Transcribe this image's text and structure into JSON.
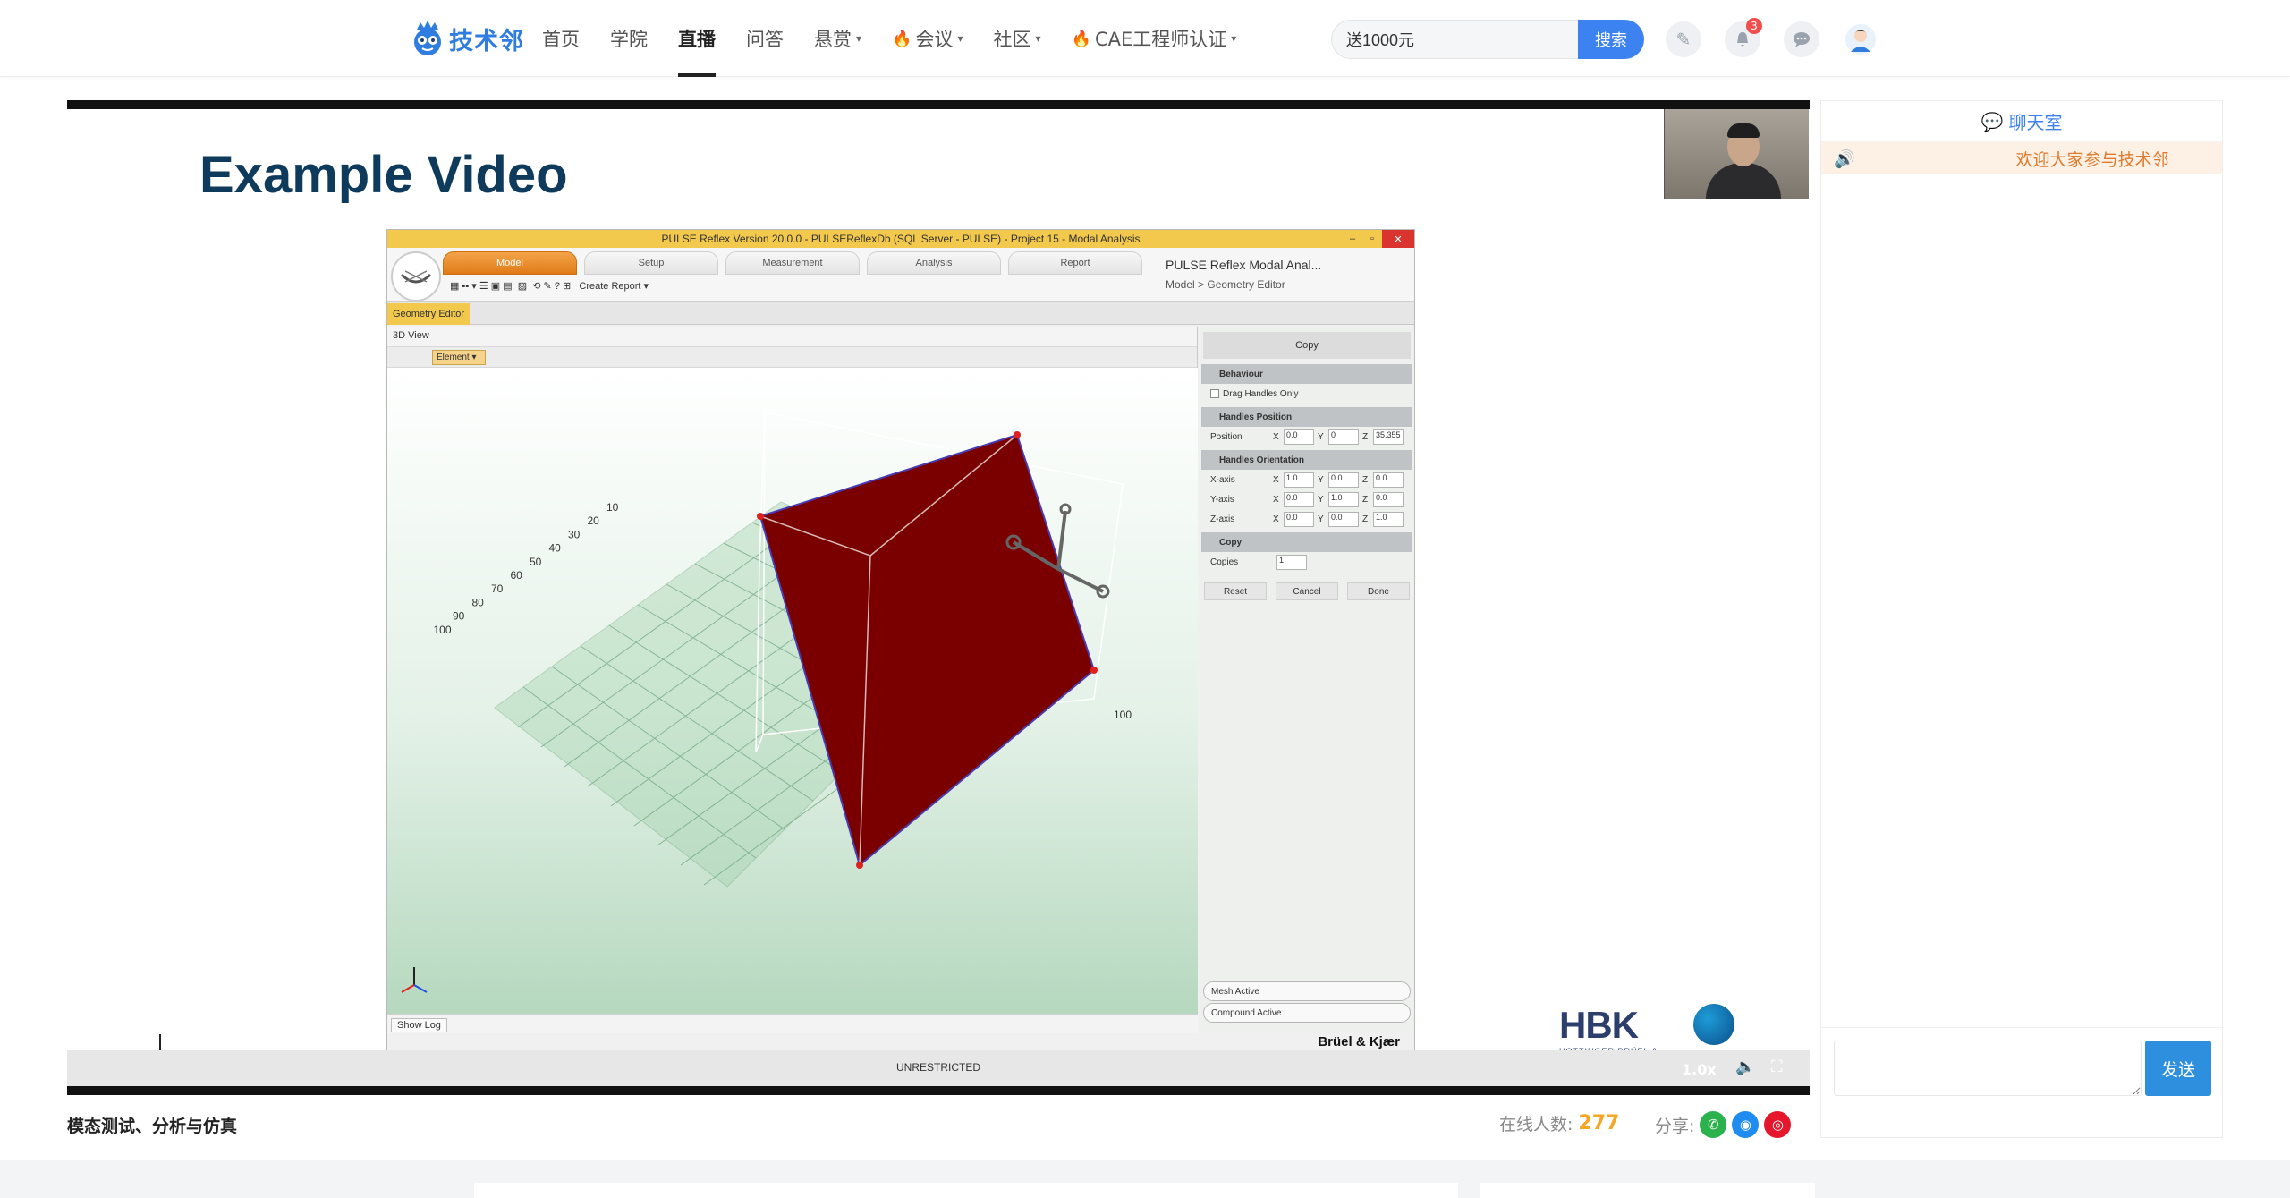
{
  "nav": {
    "logo_text": "技术邻",
    "items": [
      {
        "label": "首页",
        "active": false,
        "caret": false,
        "flame": false
      },
      {
        "label": "学院",
        "active": false,
        "caret": false,
        "flame": false
      },
      {
        "label": "直播",
        "active": true,
        "caret": false,
        "flame": false
      },
      {
        "label": "问答",
        "active": false,
        "caret": false,
        "flame": false
      },
      {
        "label": "悬赏",
        "active": false,
        "caret": true,
        "flame": false
      },
      {
        "label": "会议",
        "active": false,
        "caret": true,
        "flame": true
      },
      {
        "label": "社区",
        "active": false,
        "caret": true,
        "flame": false
      },
      {
        "label": "CAE工程师认证",
        "active": false,
        "caret": true,
        "flame": true
      }
    ],
    "search_value": "送1000元",
    "search_button": "搜索",
    "notification_count": "3"
  },
  "player": {
    "slide_title": "Example Video",
    "app": {
      "titlebar": "PULSE Reflex Version 20.0.0 - PULSEReflexDb (SQL Server - PULSE) - Project 15 - Modal Analysis",
      "tabs": [
        "Model",
        "Setup",
        "Measurement",
        "Analysis",
        "Report"
      ],
      "create_report": "Create Report",
      "ribbon_title": "PULSE Reflex  Modal Anal...",
      "ribbon_path": "Model > Geometry Editor",
      "editor_tab": "Geometry Editor",
      "viewport_title": "3D View",
      "element_select": "Element",
      "axis_ticks": [
        "10",
        "20",
        "30",
        "40",
        "50",
        "60",
        "70",
        "80",
        "90",
        "100"
      ],
      "axis_tick_right": "100",
      "props": {
        "copy_title": "Copy",
        "behaviour": "Behaviour",
        "drag_handles": "Drag Handles Only",
        "handles_position": "Handles Position",
        "position_label": "Position",
        "position": {
          "x": "0.0",
          "y": "0",
          "z": "35.355"
        },
        "handles_orientation": "Handles Orientation",
        "xaxis_label": "X-axis",
        "yaxis_label": "Y-axis",
        "zaxis_label": "Z-axis",
        "xaxis": {
          "x": "1.0",
          "y": "0.0",
          "z": "0.0"
        },
        "yaxis": {
          "x": "0.0",
          "y": "1.0",
          "z": "0.0"
        },
        "zaxis": {
          "x": "0.0",
          "y": "0.0",
          "z": "1.0"
        },
        "copy_section": "Copy",
        "copies_label": "Copies",
        "copies": "1",
        "reset": "Reset",
        "cancel": "Cancel",
        "done": "Done",
        "mesh_active": "Mesh Active",
        "compound_active": "Compound Active"
      },
      "show_log": "Show Log",
      "brand": "Brüel & Kjær"
    },
    "hbk_logo": "HBK",
    "hbk_sub": "HOTTINGER BRÜEL & KJÆR",
    "unrestricted": "UNRESTRICTED",
    "speed": "1.0x"
  },
  "video_info": {
    "title": "模态测试、分析与仿真",
    "online_label": "在线人数:",
    "online_count": "277",
    "share_label": "分享:"
  },
  "chat": {
    "title": "聊天室",
    "notice": "欢迎大家参与技术邻",
    "send_label": "发送"
  },
  "colors": {
    "accent": "#3c82f0",
    "online_count": "#f5a623",
    "notice_text": "#e07b2e",
    "panel_face": "#7a0000",
    "ribbon_active": "#e07b18"
  }
}
